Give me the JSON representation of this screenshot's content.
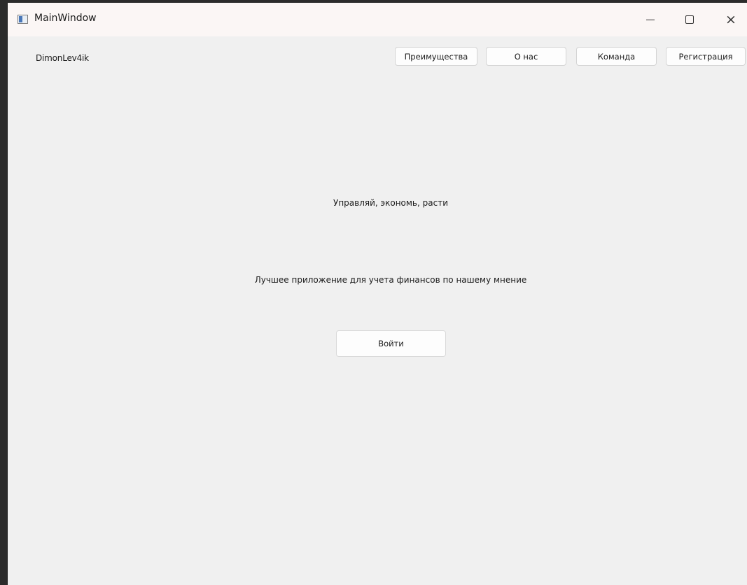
{
  "window": {
    "title": "MainWindow",
    "controls": {
      "minimize": "minimize-icon",
      "maximize": "maximize-icon",
      "close": "×"
    }
  },
  "header": {
    "brand": "DimonLev4ik",
    "nav": {
      "advantages": "Преимущества",
      "about": "О нас",
      "team": "Команда",
      "register": "Регистрация"
    }
  },
  "main": {
    "slogan": "Управляй, экономь, расти",
    "subtitle": "Лучшее приложение для учета финансов по нашему мнение",
    "login_label": "Войти"
  },
  "colors": {
    "background": "#f0f0f0",
    "button_bg": "#fdfdfd",
    "titlebar_bg": "#fbf6f5"
  }
}
